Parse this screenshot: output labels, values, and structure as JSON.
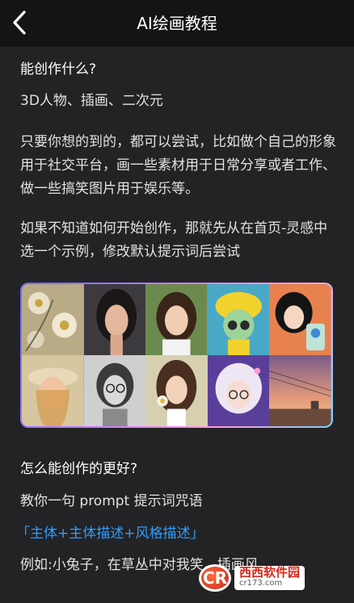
{
  "header": {
    "title": "AI绘画教程",
    "back_icon": "chevron-left-icon"
  },
  "sections": {
    "q1": "能创作什么?",
    "styles": "3D人物、插画、二次元",
    "intro": "只要你想的到的，都可以尝试，比如做个自己的形象用于社交平台，画一些素材用于日常分享或者工作、做一些搞笑图片用于娱乐等。",
    "guide": "如果不知道如何开始创作，那就先从在首页-灵感中选一个示例，修改默认提示词后尝试",
    "q2": "怎么能创作的更好?",
    "prompt_tip": "教你一句 prompt 提示词咒语",
    "formula": "「主体+主体描述+风格描述」",
    "example": "例如:小兔子，在草丛中对我笑，插画风"
  },
  "gallery": {
    "images": [
      "floral-painting",
      "woman-portrait",
      "smiling-girl-portrait",
      "3d-character-yellow-hat",
      "anime-girl-flowers",
      "vintage-girl-hat",
      "sketch-portrait-glasses",
      "girl-with-flower",
      "anime-girl-glasses",
      "sunset-landscape"
    ]
  },
  "watermark": {
    "logo": "CR",
    "main": "西西软件园",
    "sub": "cr173.com"
  },
  "colors": {
    "background": "#232325",
    "header": "#141414",
    "text": "#e2e2e2",
    "accent": "#2f9dff"
  }
}
